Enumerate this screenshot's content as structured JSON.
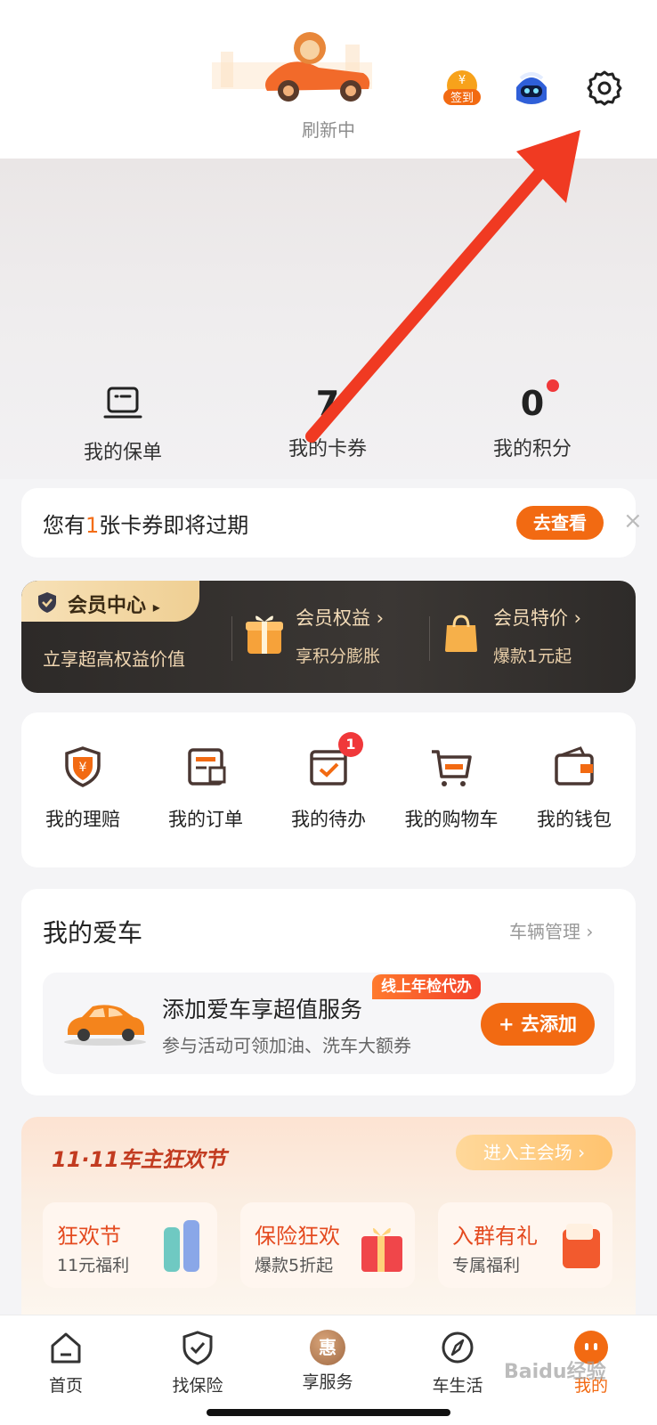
{
  "header": {
    "refresh_status": "刷新中",
    "checkin_label": "签到",
    "icons": [
      "mascot-car-icon",
      "checkin-icon",
      "robot-assistant-icon",
      "gear-icon"
    ]
  },
  "stats": [
    {
      "value": "",
      "label": "我的保单",
      "icon": "policy-icon"
    },
    {
      "value": "7",
      "label": "我的卡券"
    },
    {
      "value": "0",
      "label": "我的积分"
    }
  ],
  "notice": {
    "prefix": "您有",
    "count": "1",
    "suffix": "张卡券即将过期",
    "button": "去查看",
    "close": "×"
  },
  "member": {
    "tag": "会员中心",
    "tag_arrow": "▸",
    "subtitle": "立享超高权益价值",
    "items": [
      {
        "title": "会员权益 ›",
        "sub": "享积分膨胀",
        "icon": "gift-box-icon"
      },
      {
        "title": "会员特价 ›",
        "sub": "爆款1元起",
        "icon": "shopping-bag-icon"
      }
    ]
  },
  "quick_actions": [
    {
      "label": "我的理赔",
      "icon": "claim-shield-icon"
    },
    {
      "label": "我的订单",
      "icon": "order-icon"
    },
    {
      "label": "我的待办",
      "icon": "todo-icon",
      "badge": "1"
    },
    {
      "label": "我的购物车",
      "icon": "cart-icon"
    },
    {
      "label": "我的钱包",
      "icon": "wallet-icon"
    }
  ],
  "my_car": {
    "title": "我的爱车",
    "manage": "车辆管理 ›",
    "promo_title": "添加爱车享超值服务",
    "promo_sub": "参与活动可领加油、洗车大额券",
    "tag": "线上年检代办",
    "add_button": "+ 去添加"
  },
  "promo": {
    "title": "11·11车主狂欢节",
    "button": "进入主会场 ›",
    "cards": [
      {
        "title": "狂欢节",
        "sub": "11元福利"
      },
      {
        "title": "保险狂欢",
        "sub": "爆款5折起"
      },
      {
        "title": "入群有礼",
        "sub": "专属福利"
      }
    ]
  },
  "tabbar": [
    {
      "label": "首页",
      "icon": "home-icon"
    },
    {
      "label": "找保险",
      "icon": "shield-check-icon"
    },
    {
      "label": "享服务",
      "icon": "hui-icon",
      "glyph": "惠"
    },
    {
      "label": "车生活",
      "icon": "compass-icon"
    },
    {
      "label": "我的",
      "icon": "profile-face-icon",
      "active": true
    }
  ],
  "watermark": "Baidu经验",
  "colors": {
    "accent": "#f26a12",
    "annotation_arrow": "#f03a22",
    "member_bg": "#2d2a28"
  }
}
